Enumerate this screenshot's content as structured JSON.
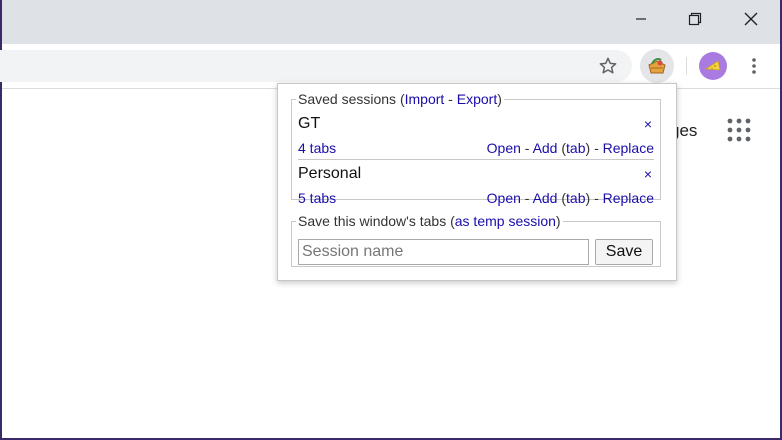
{
  "window": {
    "controls": [
      "minimize",
      "restore",
      "close"
    ]
  },
  "toolbar": {
    "icons": [
      "star-icon",
      "extension-icon",
      "profile-avatar",
      "menu-icon"
    ]
  },
  "page": {
    "partial_text": "ges"
  },
  "popup": {
    "saved_legend": {
      "prefix": "Saved sessions (",
      "import": "Import",
      "sep": " - ",
      "export": "Export",
      "suffix": ")"
    },
    "sessions": [
      {
        "name": "GT",
        "count": "4 tabs",
        "close": "×",
        "open": "Open",
        "add": "Add",
        "tab": "tab",
        "replace": "Replace"
      },
      {
        "name": "Personal",
        "count": "5 tabs",
        "close": "×",
        "open": "Open",
        "add": "Add",
        "tab": "tab",
        "replace": "Replace"
      }
    ],
    "save_legend": {
      "prefix": "Save this window's tabs (",
      "temp": "as temp session",
      "suffix": ")"
    },
    "input": {
      "placeholder": "Session name",
      "value": ""
    },
    "save_button": "Save"
  }
}
